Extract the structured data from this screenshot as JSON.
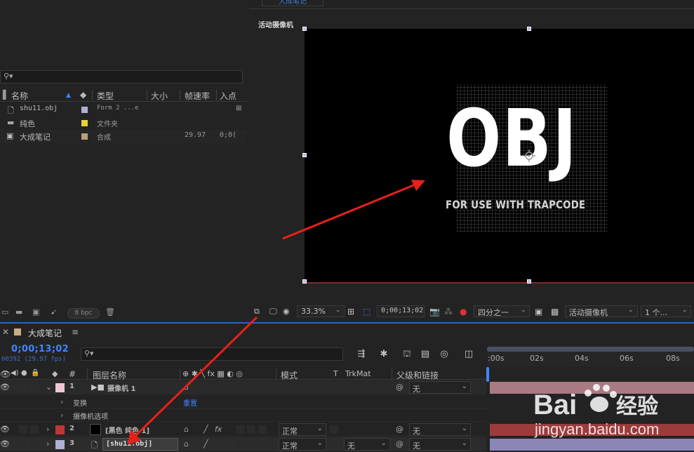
{
  "project": {
    "search_icon": "search-icon",
    "columns": [
      "名称",
      "类型",
      "大小",
      "帧速率",
      "入点"
    ],
    "items": [
      {
        "name": "shu11.obj",
        "type": "Form 2 ...e",
        "fps": "",
        "in": "",
        "color": "#b0b0d6"
      },
      {
        "name": "纯色",
        "type": "文件夹",
        "fps": "",
        "in": "",
        "color": "#e8d13a"
      },
      {
        "name": "大成笔记",
        "type": "合成",
        "fps": "29.97",
        "in": "0;0(",
        "color": "#b9a07a"
      }
    ],
    "bpc_label": "8 bpc"
  },
  "viewer": {
    "tab_label": "大成笔记",
    "camera_label": "活动摄像机",
    "comp_text": "OBJ",
    "comp_subtext": "FOR USE WITH TRAPCODE",
    "zoom": "33.3%",
    "timecode": "0;00;13;02",
    "resolution": "四分之一",
    "view": "活动摄像机",
    "views_count": "1 个..."
  },
  "timeline": {
    "comp_name": "大成笔记",
    "timecode": "0;00;13;02",
    "fps_text": "00392 (29.97 fps)",
    "ruler_ticks": [
      ":00s",
      "02s",
      "04s",
      "06s",
      "08s"
    ],
    "columns": {
      "num": "#",
      "layer_name": "图层名称",
      "mode": "模式",
      "t": "T",
      "trkmat": "TrkMat",
      "parent": "父级和链接"
    },
    "layers": [
      {
        "num": "1",
        "name": "摄像机 1",
        "mode": "",
        "trkmat": "",
        "parent": "无",
        "color": "#f0c6d4"
      },
      {
        "num": "2",
        "name": "[黑色 纯色 1]",
        "mode": "正常",
        "trkmat": "",
        "parent": "无",
        "color": "#c03636"
      },
      {
        "num": "3",
        "name": "[shu11.obj]",
        "mode": "正常",
        "trkmat": "无",
        "parent": "无",
        "color": "#b0b0d6"
      }
    ],
    "sub_rows": [
      {
        "label": "变换",
        "value": "重置"
      },
      {
        "label": "摄像机选项",
        "value": ""
      }
    ]
  },
  "watermark": {
    "brand_left": "Bai",
    "brand_right": "经验",
    "url": "jingyan.baidu.com"
  },
  "colors": {
    "accent_blue": "#3e86ff",
    "arrow_red": "#e8201a",
    "camera_bar": "#a87a84",
    "solid_bar": "#9c3b3b",
    "obj_bar": "#8a86b8"
  }
}
